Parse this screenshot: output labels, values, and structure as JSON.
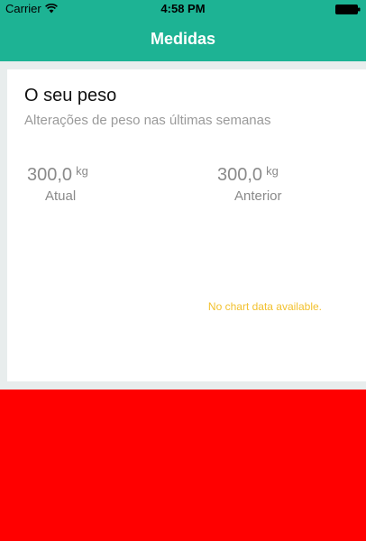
{
  "status_bar": {
    "carrier": "Carrier",
    "time": "4:58 PM"
  },
  "nav": {
    "title": "Medidas"
  },
  "weight_card": {
    "title": "O seu peso",
    "subtitle": "Alterações de peso nas últimas semanas",
    "current": {
      "value": "300,0",
      "unit": "kg",
      "label": "Atual"
    },
    "previous": {
      "value": "300,0",
      "unit": "kg",
      "label": "Anterior"
    },
    "chart_placeholder": "No chart data available."
  },
  "colors": {
    "header_bg": "#1db394",
    "card_bg": "#ffffff",
    "page_bg": "#e8eded",
    "no_data_text": "#f2c12e",
    "bottom_panel": "#ff0000"
  },
  "icons": {
    "wifi": "wifi-icon",
    "battery": "battery-icon"
  }
}
